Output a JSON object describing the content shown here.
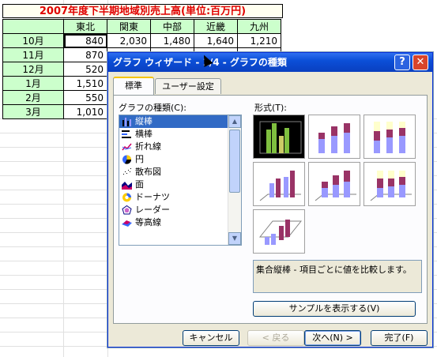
{
  "sheet": {
    "title": "2007年度下半期地域別売上高(単位:百万円)",
    "columns": [
      "東北",
      "関東",
      "中部",
      "近畿",
      "九州"
    ],
    "rows": [
      {
        "label": "10月",
        "values": [
          "840",
          "2,030",
          "1,480",
          "1,640",
          "1,210"
        ]
      },
      {
        "label": "11月",
        "values": [
          "870",
          "",
          "",
          "",
          ""
        ]
      },
      {
        "label": "12月",
        "values": [
          "520",
          "",
          "",
          "",
          ""
        ]
      },
      {
        "label": "1月",
        "values": [
          "1,510",
          "",
          "",
          "",
          ""
        ]
      },
      {
        "label": "2月",
        "values": [
          "550",
          "",
          "",
          "",
          ""
        ]
      },
      {
        "label": "3月",
        "values": [
          "1,010",
          "",
          "",
          "",
          ""
        ]
      }
    ]
  },
  "dialog": {
    "title": "グラフ ウィザード - 1/4 - グラフの種類",
    "help_label": "?",
    "close_label": "✕",
    "tabs": [
      {
        "label": "標準"
      },
      {
        "label": "ユーザー設定"
      }
    ],
    "chart_type_label": "グラフの種類(C):",
    "subtype_label": "形式(T):",
    "chart_types": [
      {
        "label": "縦棒",
        "icon": "column-chart-icon"
      },
      {
        "label": "横棒",
        "icon": "bar-chart-icon"
      },
      {
        "label": "折れ線",
        "icon": "line-chart-icon"
      },
      {
        "label": "円",
        "icon": "pie-chart-icon"
      },
      {
        "label": "散布図",
        "icon": "scatter-chart-icon"
      },
      {
        "label": "面",
        "icon": "area-chart-icon"
      },
      {
        "label": "ドーナツ",
        "icon": "doughnut-chart-icon"
      },
      {
        "label": "レーダー",
        "icon": "radar-chart-icon"
      },
      {
        "label": "等高線",
        "icon": "surface-chart-icon"
      }
    ],
    "selected_chart_type": "縦棒",
    "description": "集合縦棒 - 項目ごとに値を比較します。",
    "sample_button": "サンプルを表示する(V)",
    "buttons": {
      "cancel": "キャンセル",
      "back": "< 戻る",
      "next": "次へ(N) >",
      "finish": "完了(F)"
    },
    "colors": {
      "titlebar": "#0b4fd8",
      "selection": "#316ac5",
      "series1": "#9999ff",
      "series2": "#993366",
      "series3": "#ffffcc"
    }
  }
}
